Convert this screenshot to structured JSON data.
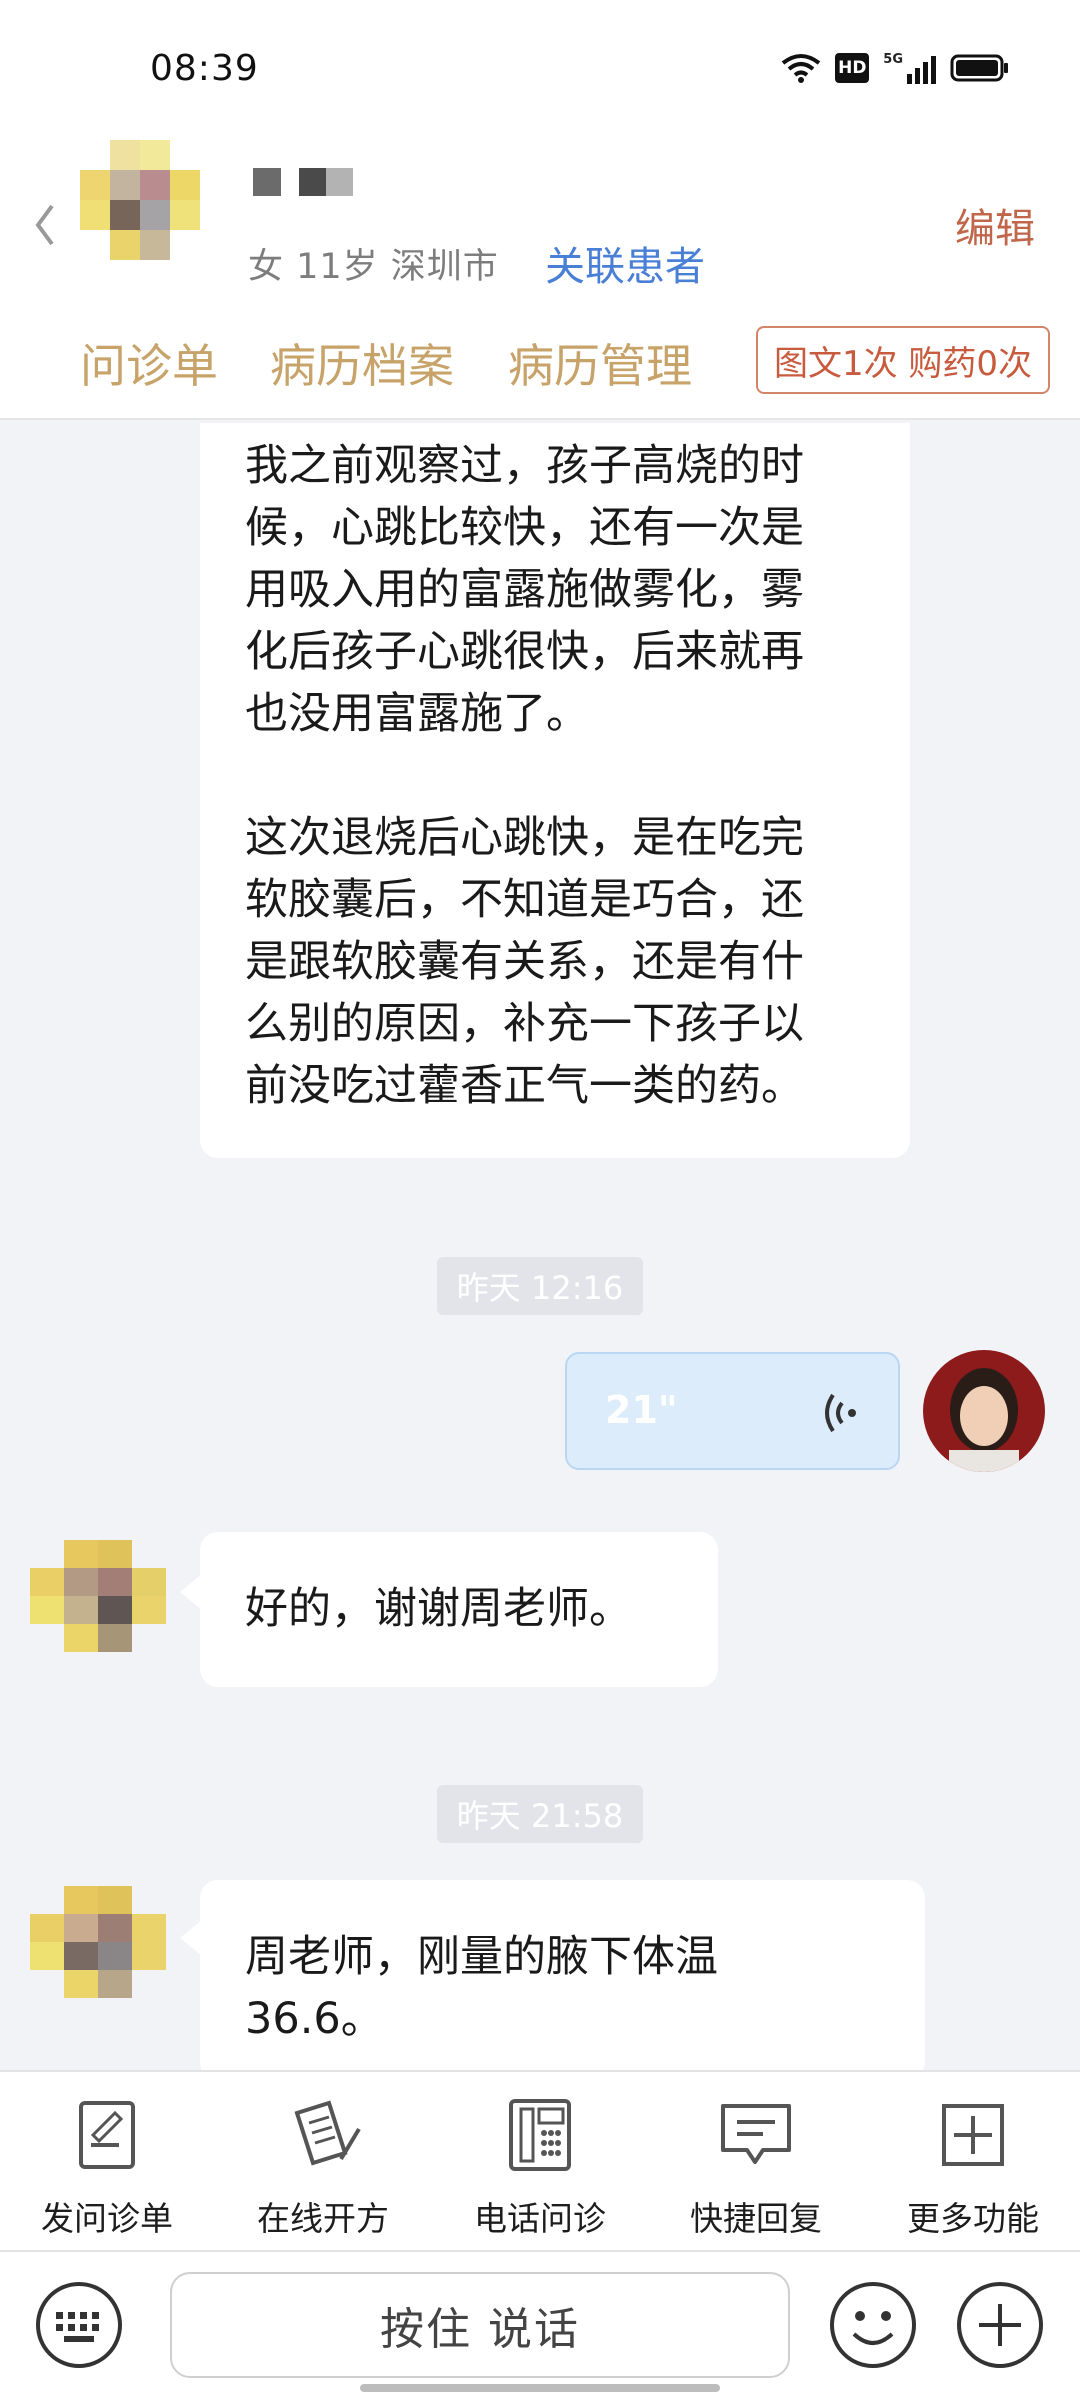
{
  "status_bar": {
    "time": "08:39",
    "net_label": "5G",
    "hd_label": "HD"
  },
  "header": {
    "patient_info": "女 11岁  深圳市",
    "link_patient_label": "关联患者",
    "edit_label": "编辑",
    "tabs": [
      {
        "label": "问诊单"
      },
      {
        "label": "病历档案"
      },
      {
        "label": "病历管理"
      }
    ],
    "consult_badge": "图文1次 购药0次"
  },
  "messages": {
    "m1_p1": [
      "我之前观察过，孩子高烧的时",
      "候，心跳比较快，还有一次是",
      "用吸入用的富露施做雾化，雾",
      "化后孩子心跳很快，后来就再",
      "也没用富露施了。"
    ],
    "m1_p2": [
      "这次退烧后心跳快，是在吃完",
      "软胶囊后，不知道是巧合，还",
      "是跟软胶囊有关系，还是有什",
      "么别的原因，补充一下孩子以",
      "前没吃过藿香正气一类的药。"
    ],
    "time1": "昨天 12:16",
    "voice_duration": "21\"",
    "m2": "好的，谢谢周老师。",
    "time2": "昨天 21:58",
    "m3": [
      "周老师，刚量的腋下体温",
      "36.6。"
    ]
  },
  "toolbar": [
    {
      "label": "发问诊单",
      "icon": "form-icon"
    },
    {
      "label": "在线开方",
      "icon": "prescription-icon"
    },
    {
      "label": "电话问诊",
      "icon": "phone-icon"
    },
    {
      "label": "快捷回复",
      "icon": "quick-reply-icon"
    },
    {
      "label": "更多功能",
      "icon": "more-icon"
    }
  ],
  "input": {
    "hold_to_talk": "按住 说话"
  },
  "colors": {
    "accent_tab": "#c7a36a",
    "link": "#4a7fd6",
    "badge": "#c85b3e",
    "voice_bubble": "#dcecfb"
  }
}
